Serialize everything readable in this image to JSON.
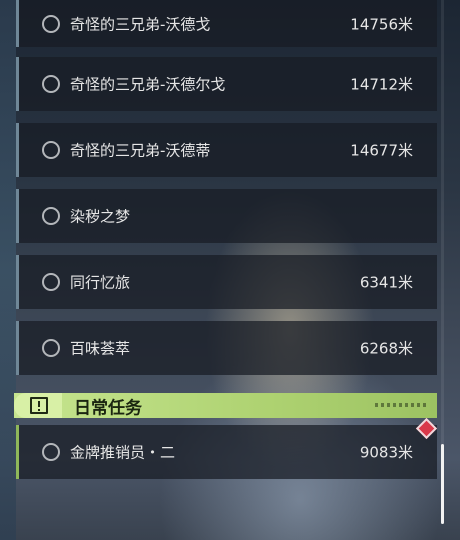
{
  "tasks": [
    {
      "name": "奇怪的三兄弟-沃德戈",
      "distance": "14756米"
    },
    {
      "name": "奇怪的三兄弟-沃德尔戈",
      "distance": "14712米"
    },
    {
      "name": "奇怪的三兄弟-沃德蒂",
      "distance": "14677米"
    },
    {
      "name": "染秽之梦",
      "distance": ""
    },
    {
      "name": "同行忆旅",
      "distance": "6341米"
    },
    {
      "name": "百味荟萃",
      "distance": "6268米"
    }
  ],
  "daily_section": {
    "title": "日常任务",
    "tasks": [
      {
        "name": "金牌推销员・二",
        "distance": "9083米"
      }
    ]
  },
  "colors": {
    "daily_accent": "#b6d97c",
    "main_accent": "#6f8797",
    "badge": "#d9394a"
  },
  "icons": {
    "task_status": "circle-icon",
    "section": "alert-icon",
    "badge": "diamond-badge-icon"
  }
}
